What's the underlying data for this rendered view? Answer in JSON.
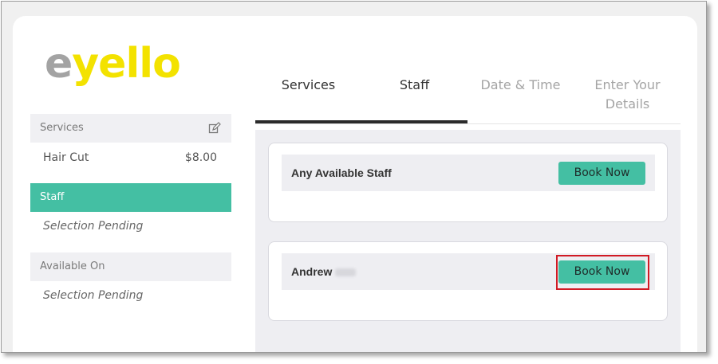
{
  "brand": {
    "logo_first": "e",
    "logo_rest": "yello",
    "logo_colors": [
      "#a3a3a3",
      "#f3e200"
    ]
  },
  "sidebar": {
    "services_header": "Services",
    "services_icon": "edit-icon",
    "service_item": {
      "name": "Hair Cut",
      "price": "$8.00"
    },
    "staff_header": "Staff",
    "staff_value": "Selection Pending",
    "available_header": "Available On",
    "available_value": "Selection Pending"
  },
  "tabs": [
    {
      "label": "Services",
      "state": "completed"
    },
    {
      "label": "Staff",
      "state": "active"
    },
    {
      "label": "Date & Time",
      "state": "pending"
    },
    {
      "label": "Enter Your Details",
      "state": "pending"
    }
  ],
  "staff_list": [
    {
      "name": "Any Available Staff",
      "button": "Book Now",
      "highlighted": false
    },
    {
      "name": "Andrew",
      "name_redacted": true,
      "button": "Book Now",
      "highlighted": true
    }
  ],
  "colors": {
    "accent": "#44bfa3",
    "highlight_border": "#d11a24",
    "panel_bg": "#eeeef2"
  }
}
